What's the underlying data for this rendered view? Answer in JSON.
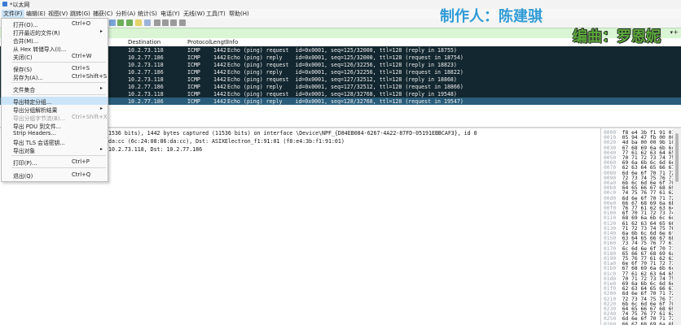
{
  "window": {
    "title": "*以太网"
  },
  "menu": [
    "文件(F)",
    "编辑(E)",
    "视图(V)",
    "跳转(G)",
    "捕获(C)",
    "分析(A)",
    "统计(S)",
    "电话(Y)",
    "无线(W)",
    "工具(T)",
    "帮助(H)"
  ],
  "columns": {
    "destination": "Destination",
    "protocol": "Protocol",
    "length": "Lengtl",
    "info": "Info"
  },
  "packets": [
    {
      "dst": "10.2.73.118",
      "proto": "ICMP",
      "len": "1442",
      "info": "Echo (ping) request  id=0x0001, seq=125/32000, ttl=128 (reply in 18755)"
    },
    {
      "dst": "10.2.77.186",
      "proto": "ICMP",
      "len": "1442",
      "info": "Echo (ping) reply    id=0x0001, seq=125/32000, ttl=128 (request in 18754)"
    },
    {
      "dst": "10.2.73.118",
      "proto": "ICMP",
      "len": "1442",
      "info": "Echo (ping) request  id=0x0001, seq=126/32256, ttl=128 (reply in 18823)"
    },
    {
      "dst": "10.2.77.186",
      "proto": "ICMP",
      "len": "1442",
      "info": "Echo (ping) reply    id=0x0001, seq=126/32256, ttl=128 (request in 18822)"
    },
    {
      "dst": "10.2.73.118",
      "proto": "ICMP",
      "len": "1442",
      "info": "Echo (ping) request  id=0x0001, seq=127/32512, ttl=128 (reply in 18868)"
    },
    {
      "dst": "10.2.77.186",
      "proto": "ICMP",
      "len": "1442",
      "info": "Echo (ping) reply    id=0x0001, seq=127/32512, ttl=128 (request in 18866)"
    },
    {
      "dst": "10.2.73.118",
      "proto": "ICMP",
      "len": "1442",
      "info": "Echo (ping) request  id=0x0001, seq=128/32768, ttl=128 (reply in 19548)"
    },
    {
      "dst": "10.2.77.186",
      "proto": "ICMP",
      "len": "1442",
      "info": "Echo (ping) reply    id=0x0001, seq=128/32768, ttl=128 (request in 19547)"
    }
  ],
  "details": [
    "1536 bits), 1442 bytes captured (11536 bits) on interface \\Device\\NPF_{D84EB084-6267-4A22-87FD-05191EBBCAF3}, id 0",
    "da:cc (6c:24:08:86:da:cc), Dst: ASIXElectron_f1:91:01 (f8:e4:3b:f1:91:01)",
    "10.2.73.118, Dst: 10.2.77.186"
  ],
  "file_menu": [
    {
      "label": "打开(O)...",
      "shortcut": "Ctrl+O",
      "sub": false,
      "disabled": false
    },
    {
      "label": "打开最近的文件(R)",
      "shortcut": "",
      "sub": true,
      "disabled": false
    },
    {
      "label": "合并(M)...",
      "shortcut": "",
      "sub": false,
      "disabled": false
    },
    {
      "label": "从 Hex 转储导入(I)...",
      "shortcut": "",
      "sub": false,
      "disabled": false
    },
    {
      "label": "关闭(C)",
      "shortcut": "Ctrl+W",
      "sub": false,
      "disabled": false
    },
    {
      "label": "保存(S)",
      "shortcut": "Ctrl+S",
      "sub": false,
      "disabled": false
    },
    {
      "label": "另存为(A)...",
      "shortcut": "Ctrl+Shift+S",
      "sub": false,
      "disabled": false
    },
    {
      "label": "文件集合",
      "shortcut": "",
      "sub": true,
      "disabled": false
    },
    {
      "label": "导出特定分组...",
      "shortcut": "",
      "sub": false,
      "disabled": false
    },
    {
      "label": "导出分组解析结果",
      "shortcut": "",
      "sub": true,
      "disabled": false
    },
    {
      "label": "导出分组字节流(B)...",
      "shortcut": "Ctrl+Shift+X",
      "sub": false,
      "disabled": true
    },
    {
      "label": "导出 PDU 到文件...",
      "shortcut": "",
      "sub": false,
      "disabled": false
    },
    {
      "label": "Strip Headers...",
      "shortcut": "",
      "sub": false,
      "disabled": false
    },
    {
      "label": "导出 TLS 会话密钥...",
      "shortcut": "",
      "sub": false,
      "disabled": false
    },
    {
      "label": "导出对象",
      "shortcut": "",
      "sub": true,
      "disabled": false
    },
    {
      "label": "打印(P)...",
      "shortcut": "Ctrl+P",
      "sub": false,
      "disabled": false
    },
    {
      "label": "退出(Q)",
      "shortcut": "Ctrl+Q",
      "sub": false,
      "disabled": false
    }
  ],
  "hex": {
    "offsets": [
      "0000",
      "0010",
      "0020",
      "0030",
      "0040",
      "0050",
      "0060",
      "0070",
      "0080",
      "0090",
      "00a0",
      "00b0",
      "00c0",
      "00d0",
      "00e0",
      "00f0",
      "0100",
      "0110",
      "0120",
      "0130",
      "0140",
      "0150",
      "0160",
      "0170",
      "0180",
      "0190",
      "01a0",
      "01b0",
      "01c0",
      "01d0",
      "01e0",
      "01f0",
      "0200",
      "0210",
      "0220",
      "0230",
      "0240",
      "0250",
      "0260",
      "0270"
    ],
    "bytes": [
      "f8 e4 3b f1 91 01",
      "05 94 47 fb 00 00",
      "4d ba 00 00 9b 10",
      "67 68 69 6a 6b 6c",
      "77 61 62 63 64 65",
      "70 71 72 73 74 75",
      "69 6a 6b 6c 6d 6e",
      "62 63 64 65 66 67",
      "6d 6e 6f 70 71 72",
      "72 73 74 75 76 77",
      "6b 6c 6d 6e 6f 70",
      "64 65 66 67 68 69",
      "74 75 76 77 61 62",
      "6d 6e 6f 70 71 72",
      "66 67 68 69 6a 6b",
      "76 77 61 62 63 64",
      "6f 70 71 72 73 74",
      "68 69 6a 6b 6c 6d",
      "61 62 63 64 65 66",
      "71 72 73 74 75 76",
      "6a 6b 6c 6d 6e 6f",
      "63 64 65 66 67 68",
      "73 74 75 76 77 61",
      "6c 6d 6e 6f 70 71",
      "65 66 67 68 69 6a",
      "75 76 77 61 62 63",
      "6e 6f 70 71 72 73",
      "67 68 69 6a 6b 6c",
      "77 61 62 63 64 65",
      "70 71 72 73 74 75",
      "69 6a 6b 6c 6d 6e",
      "62 63 64 65 66 67",
      "6d 6e 6f 70 71 72",
      "72 73 74 75 76 77",
      "6b 6c 6d 6e 6f 70",
      "64 65 66 67 68 69",
      "74 75 76 77 61 62",
      "6d 6e 6f 70 71 72",
      "66 67 68 69 6a 6b",
      "76 77 61 62 63 64"
    ]
  },
  "watermarks": {
    "author": "制作人：陈建骐",
    "editor": "编曲：罗恩妮"
  },
  "colors": {
    "packet_row": "#12272f",
    "packet_selected": "#2a5d7b",
    "filter_bg": "#d9f5d3",
    "menu_highlight": "#cce4f7"
  }
}
